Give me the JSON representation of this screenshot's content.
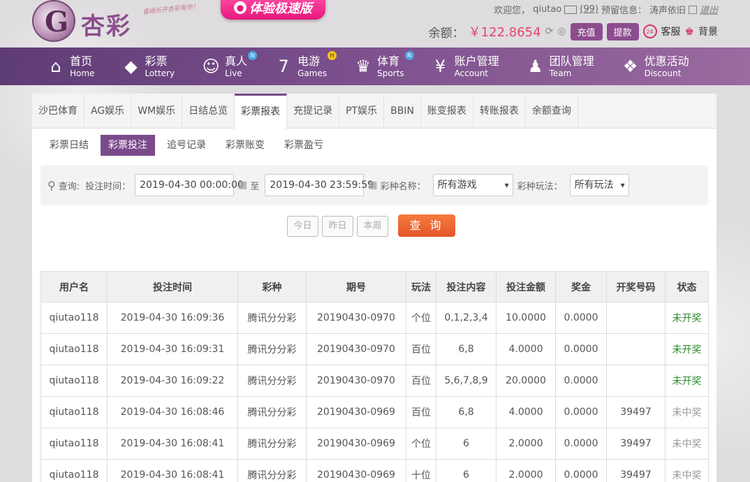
{
  "header": {
    "logo_name": "杏彩",
    "slogan": "喜缘乐开杏彩有你！",
    "experience_button": "体验极速版",
    "welcome": "欢迎您，",
    "username": "qiutao",
    "message_count": "(99)",
    "reserve_label": "预留信息：",
    "reserve_value": "涛声依旧",
    "logout": "退出",
    "balance_label": "余额：",
    "balance_value": "￥122.8654",
    "deposit_button": "充值",
    "withdraw_button": "提款",
    "service_badge": "24",
    "service_label": "客服",
    "background_label": "背景",
    "accent_color": "#7a4a8a"
  },
  "nav": [
    {
      "cn": "首页",
      "en": "Home",
      "icon": "home-icon",
      "glyph": "⌂",
      "badge": ""
    },
    {
      "cn": "彩票",
      "en": "Lottery",
      "icon": "lottery-icon",
      "glyph": "◆",
      "badge": ""
    },
    {
      "cn": "真人",
      "en": "Live",
      "icon": "live-icon",
      "glyph": "☺",
      "badge": "N"
    },
    {
      "cn": "电游",
      "en": "Games",
      "icon": "games-icon",
      "glyph": "7",
      "badge": "H"
    },
    {
      "cn": "体育",
      "en": "Sports",
      "icon": "sports-icon",
      "glyph": "♛",
      "badge": "N"
    },
    {
      "cn": "账户管理",
      "en": "Account",
      "icon": "account-icon",
      "glyph": "¥",
      "badge": ""
    },
    {
      "cn": "团队管理",
      "en": "Team",
      "icon": "team-icon",
      "glyph": "♟",
      "badge": ""
    },
    {
      "cn": "优惠活动",
      "en": "Discount",
      "icon": "gift-icon",
      "glyph": "❖",
      "badge": ""
    }
  ],
  "tabs": [
    "沙巴体育",
    "AG娱乐",
    "WM娱乐",
    "日结总览",
    "彩票报表",
    "充提记录",
    "PT娱乐",
    "BBIN",
    "账变报表",
    "转账报表",
    "余额查询"
  ],
  "active_tab": 4,
  "subtabs": [
    "彩票日结",
    "彩票投注",
    "追号记录",
    "彩票账变",
    "彩票盈亏"
  ],
  "active_subtab": 1,
  "search": {
    "query_label": "查询:",
    "time_label": "投注时间：",
    "start_time": "2019-04-30 00:00:00",
    "to_label": "至",
    "end_time": "2019-04-30 23:59:59",
    "game_label": "彩种名称：",
    "game_value": "所有游戏",
    "play_label": "彩种玩法：",
    "play_value": "所有玩法",
    "today": "今日",
    "yesterday": "昨日",
    "this_week": "本周",
    "query_button": "查 询"
  },
  "table": {
    "columns": [
      "用户名",
      "投注时间",
      "彩种",
      "期号",
      "玩法",
      "投注内容",
      "投注金额",
      "奖金",
      "开奖号码",
      "状态"
    ],
    "rows": [
      [
        "qiutao118",
        "2019-04-30 16:09:36",
        "腾讯分分彩",
        "20190430-0970",
        "个位",
        "0,1,2,3,4",
        "10.0000",
        "0.0000",
        "",
        "未开奖"
      ],
      [
        "qiutao118",
        "2019-04-30 16:09:31",
        "腾讯分分彩",
        "20190430-0970",
        "百位",
        "6,8",
        "4.0000",
        "0.0000",
        "",
        "未开奖"
      ],
      [
        "qiutao118",
        "2019-04-30 16:09:22",
        "腾讯分分彩",
        "20190430-0970",
        "百位",
        "5,6,7,8,9",
        "20.0000",
        "0.0000",
        "",
        "未开奖"
      ],
      [
        "qiutao118",
        "2019-04-30 16:08:46",
        "腾讯分分彩",
        "20190430-0969",
        "百位",
        "6,8",
        "4.0000",
        "0.0000",
        "39497",
        "未中奖"
      ],
      [
        "qiutao118",
        "2019-04-30 16:08:41",
        "腾讯分分彩",
        "20190430-0969",
        "个位",
        "6",
        "2.0000",
        "0.0000",
        "39497",
        "未中奖"
      ],
      [
        "qiutao118",
        "2019-04-30 16:08:41",
        "腾讯分分彩",
        "20190430-0969",
        "十位",
        "6",
        "2.0000",
        "0.0000",
        "39497",
        "未中奖"
      ]
    ]
  }
}
